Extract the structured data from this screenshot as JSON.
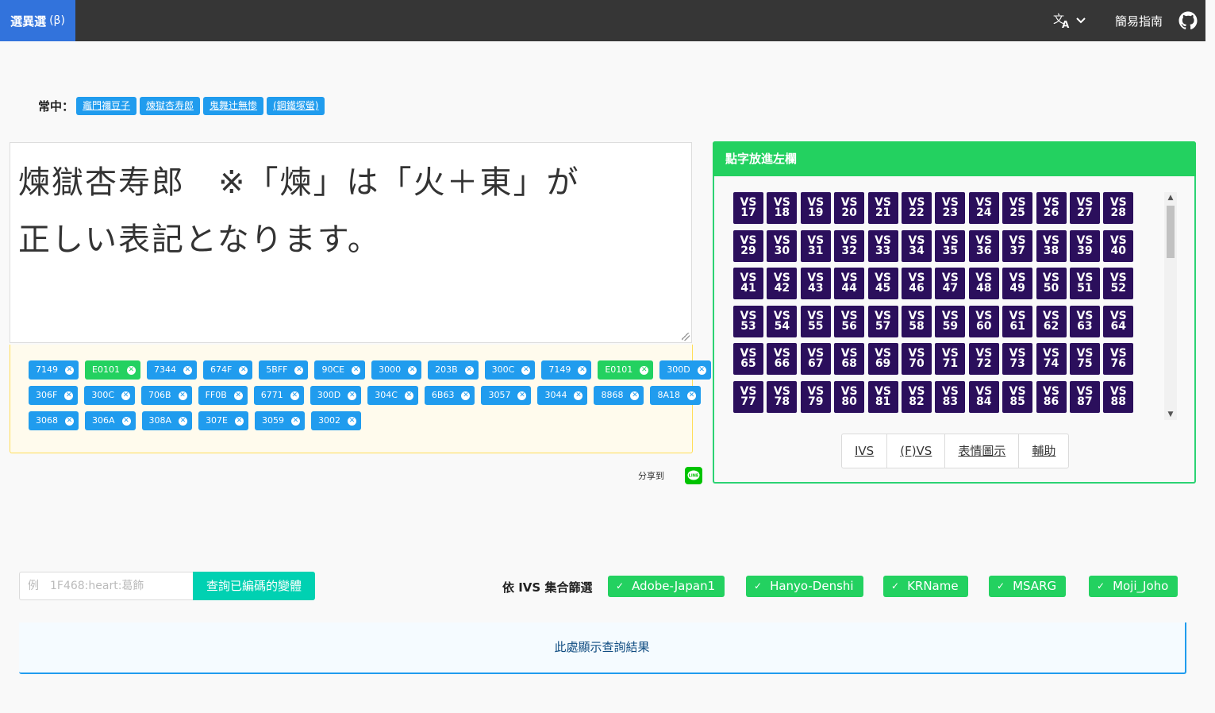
{
  "navbar": {
    "brand": "選異選",
    "brand_beta": "(β)",
    "guide": "簡易指南",
    "lang_icon": "translate-icon",
    "github_icon": "github-icon"
  },
  "common": {
    "label": "常中：",
    "links": [
      "竈門禰豆子",
      "煉獄杏寿郎",
      "鬼舞辻無惨",
      "(鋼鐵塚螢)"
    ]
  },
  "editor": {
    "line1": "煉獄杏寿郎　※「煉」は「火＋東」が",
    "line2": "正しい表記となります。"
  },
  "codes": [
    [
      {
        "code": "7149",
        "green": false
      },
      {
        "code": "E0101",
        "green": true
      },
      {
        "code": "7344",
        "green": false
      },
      {
        "code": "674F",
        "green": false
      },
      {
        "code": "5BFF",
        "green": false
      },
      {
        "code": "90CE",
        "green": false
      },
      {
        "code": "3000",
        "green": false
      },
      {
        "code": "203B",
        "green": false
      },
      {
        "code": "300C",
        "green": false
      },
      {
        "code": "7149",
        "green": false
      },
      {
        "code": "E0101",
        "green": true
      },
      {
        "code": "300D",
        "green": false
      }
    ],
    [
      {
        "code": "306F",
        "green": false
      },
      {
        "code": "300C",
        "green": false
      },
      {
        "code": "706B",
        "green": false
      },
      {
        "code": "FF0B",
        "green": false
      },
      {
        "code": "6771",
        "green": false
      },
      {
        "code": "300D",
        "green": false
      },
      {
        "code": "304C",
        "green": false
      },
      {
        "code": "6B63",
        "green": false
      },
      {
        "code": "3057",
        "green": false
      },
      {
        "code": "3044",
        "green": false
      },
      {
        "code": "8868",
        "green": false
      },
      {
        "code": "8A18",
        "green": false
      }
    ],
    [
      {
        "code": "3068",
        "green": false
      },
      {
        "code": "306A",
        "green": false
      },
      {
        "code": "308A",
        "green": false
      },
      {
        "code": "307E",
        "green": false
      },
      {
        "code": "3059",
        "green": false
      },
      {
        "code": "3002",
        "green": false
      }
    ]
  ],
  "share": {
    "label": "分享到",
    "icon": "line-icon"
  },
  "panel": {
    "title": "點字放進左欄",
    "vs_prefix": "VS",
    "vs_start": 17,
    "vs_end": 88,
    "tabs": [
      "IVS",
      "(F)VS",
      "表情圖示",
      "輔助"
    ]
  },
  "search": {
    "placeholder": "例　1F468:heart:葛飾",
    "button": "查詢已編碼的變體"
  },
  "filters": {
    "label": "依 IVS 集合篩選",
    "items": [
      "Adobe-Japan1",
      "Hanyo-Denshi",
      "KRName",
      "MSARG",
      "Moji_Joho"
    ]
  },
  "results": {
    "placeholder": "此處顯示查詢結果"
  },
  "colors": {
    "blue": "#209cee",
    "green": "#23d160",
    "purple": "#2b0f5c",
    "teal": "#00d1b2",
    "dark": "#363636"
  }
}
